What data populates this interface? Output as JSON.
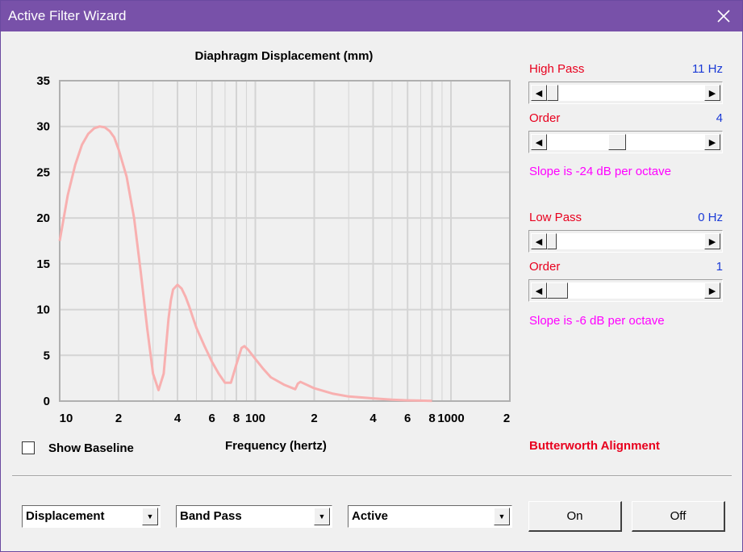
{
  "window": {
    "title": "Active Filter Wizard"
  },
  "chart_data": {
    "type": "line",
    "title": "Diaphragm Displacement (mm)",
    "xlabel": "Frequency (hertz)",
    "ylabel": "",
    "xscale": "log",
    "xlim": [
      10,
      2000
    ],
    "ylim": [
      0,
      35
    ],
    "yticks": [
      0,
      5,
      10,
      15,
      20,
      25,
      30,
      35
    ],
    "xtick_labels": [
      "10",
      "2",
      "4",
      "6",
      "8",
      "100",
      "2",
      "4",
      "6",
      "8",
      "1000",
      "2"
    ],
    "grid": true,
    "series": [
      {
        "color": "#f8b0b0",
        "x": [
          10,
          11,
          12,
          13,
          14,
          15,
          16,
          17,
          18,
          19,
          20,
          22,
          24,
          26,
          28,
          30,
          32,
          34,
          35,
          36,
          37,
          38,
          40,
          42,
          44,
          46,
          48,
          50,
          55,
          60,
          65,
          70,
          75,
          80,
          85,
          88,
          92,
          100,
          110,
          120,
          140,
          160,
          165,
          170,
          200,
          250,
          300,
          400,
          500,
          600,
          700,
          800
        ],
        "y": [
          17.5,
          22.5,
          25.8,
          28,
          29.2,
          29.8,
          30,
          29.9,
          29.5,
          28.8,
          27.5,
          24.5,
          20,
          14,
          8,
          3,
          1.2,
          3,
          6,
          9,
          11,
          12.2,
          12.7,
          12.3,
          11.4,
          10.3,
          9.1,
          8,
          6,
          4.3,
          3,
          2,
          2,
          4,
          5.8,
          6,
          5.6,
          4.6,
          3.5,
          2.6,
          1.8,
          1.3,
          1.9,
          2.1,
          1.4,
          0.8,
          0.5,
          0.3,
          0.15,
          0.08,
          0.05,
          0.03
        ]
      }
    ]
  },
  "baseline": {
    "label": "Show Baseline",
    "checked": false
  },
  "right_panel": {
    "high_pass": {
      "label": "High Pass",
      "value": "11 Hz"
    },
    "high_order": {
      "label": "Order",
      "value": "4",
      "slope": "Slope is -24 dB per octave"
    },
    "low_pass": {
      "label": "Low Pass",
      "value": "0 Hz"
    },
    "low_order": {
      "label": "Order",
      "value": "1",
      "slope": "Slope is -6 dB per octave"
    },
    "alignment": "Butterworth Alignment"
  },
  "controls": {
    "plot_type": "Displacement",
    "filter_type": "Band Pass",
    "mode": "Active",
    "on_label": "On",
    "off_label": "Off"
  },
  "colors": {
    "title_bar": "#7851a9",
    "curve": "#f8b0b0",
    "red": "#e8001e",
    "blue": "#1a3ad6",
    "magenta": "#ff00ff"
  }
}
